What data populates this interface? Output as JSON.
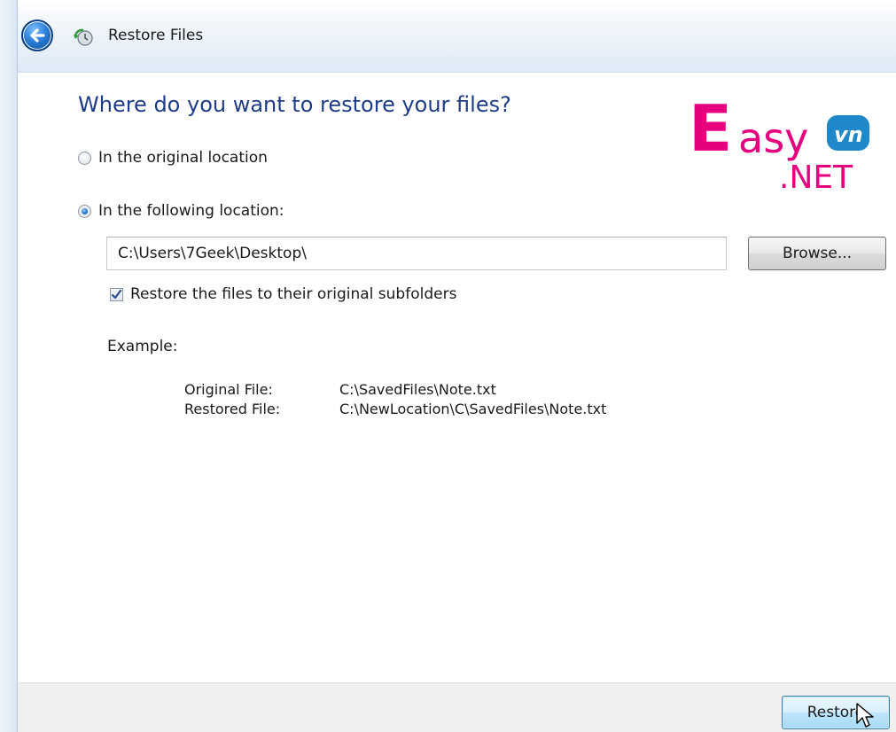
{
  "window": {
    "title": "Restore Files",
    "back_icon": "back-arrow-icon",
    "title_icon": "restore-files-icon"
  },
  "main": {
    "heading": "Where do you want to restore your files?",
    "options": [
      {
        "label": "In the original location",
        "selected": false
      },
      {
        "label": "In the following location:",
        "selected": true
      }
    ],
    "location_value": "C:\\Users\\7Geek\\Desktop\\",
    "browse_label": "Browse...",
    "subfolders_label": "Restore the files to their original subfolders",
    "subfolders_checked": true,
    "example_label": "Example:",
    "example": {
      "original_key": "Original File:",
      "original_value": "C:\\SavedFiles\\Note.txt",
      "restored_key": "Restored File:",
      "restored_value": "C:\\NewLocation\\C\\SavedFiles\\Note.txt"
    }
  },
  "watermark": {
    "brand": "Easy",
    "badge": "vn",
    "suffix": ".NET"
  },
  "footer": {
    "restore_label": "Restore"
  },
  "colors": {
    "heading": "#1f3c88",
    "watermark_pink": "#e6007e",
    "watermark_blue": "#1e88c8"
  }
}
